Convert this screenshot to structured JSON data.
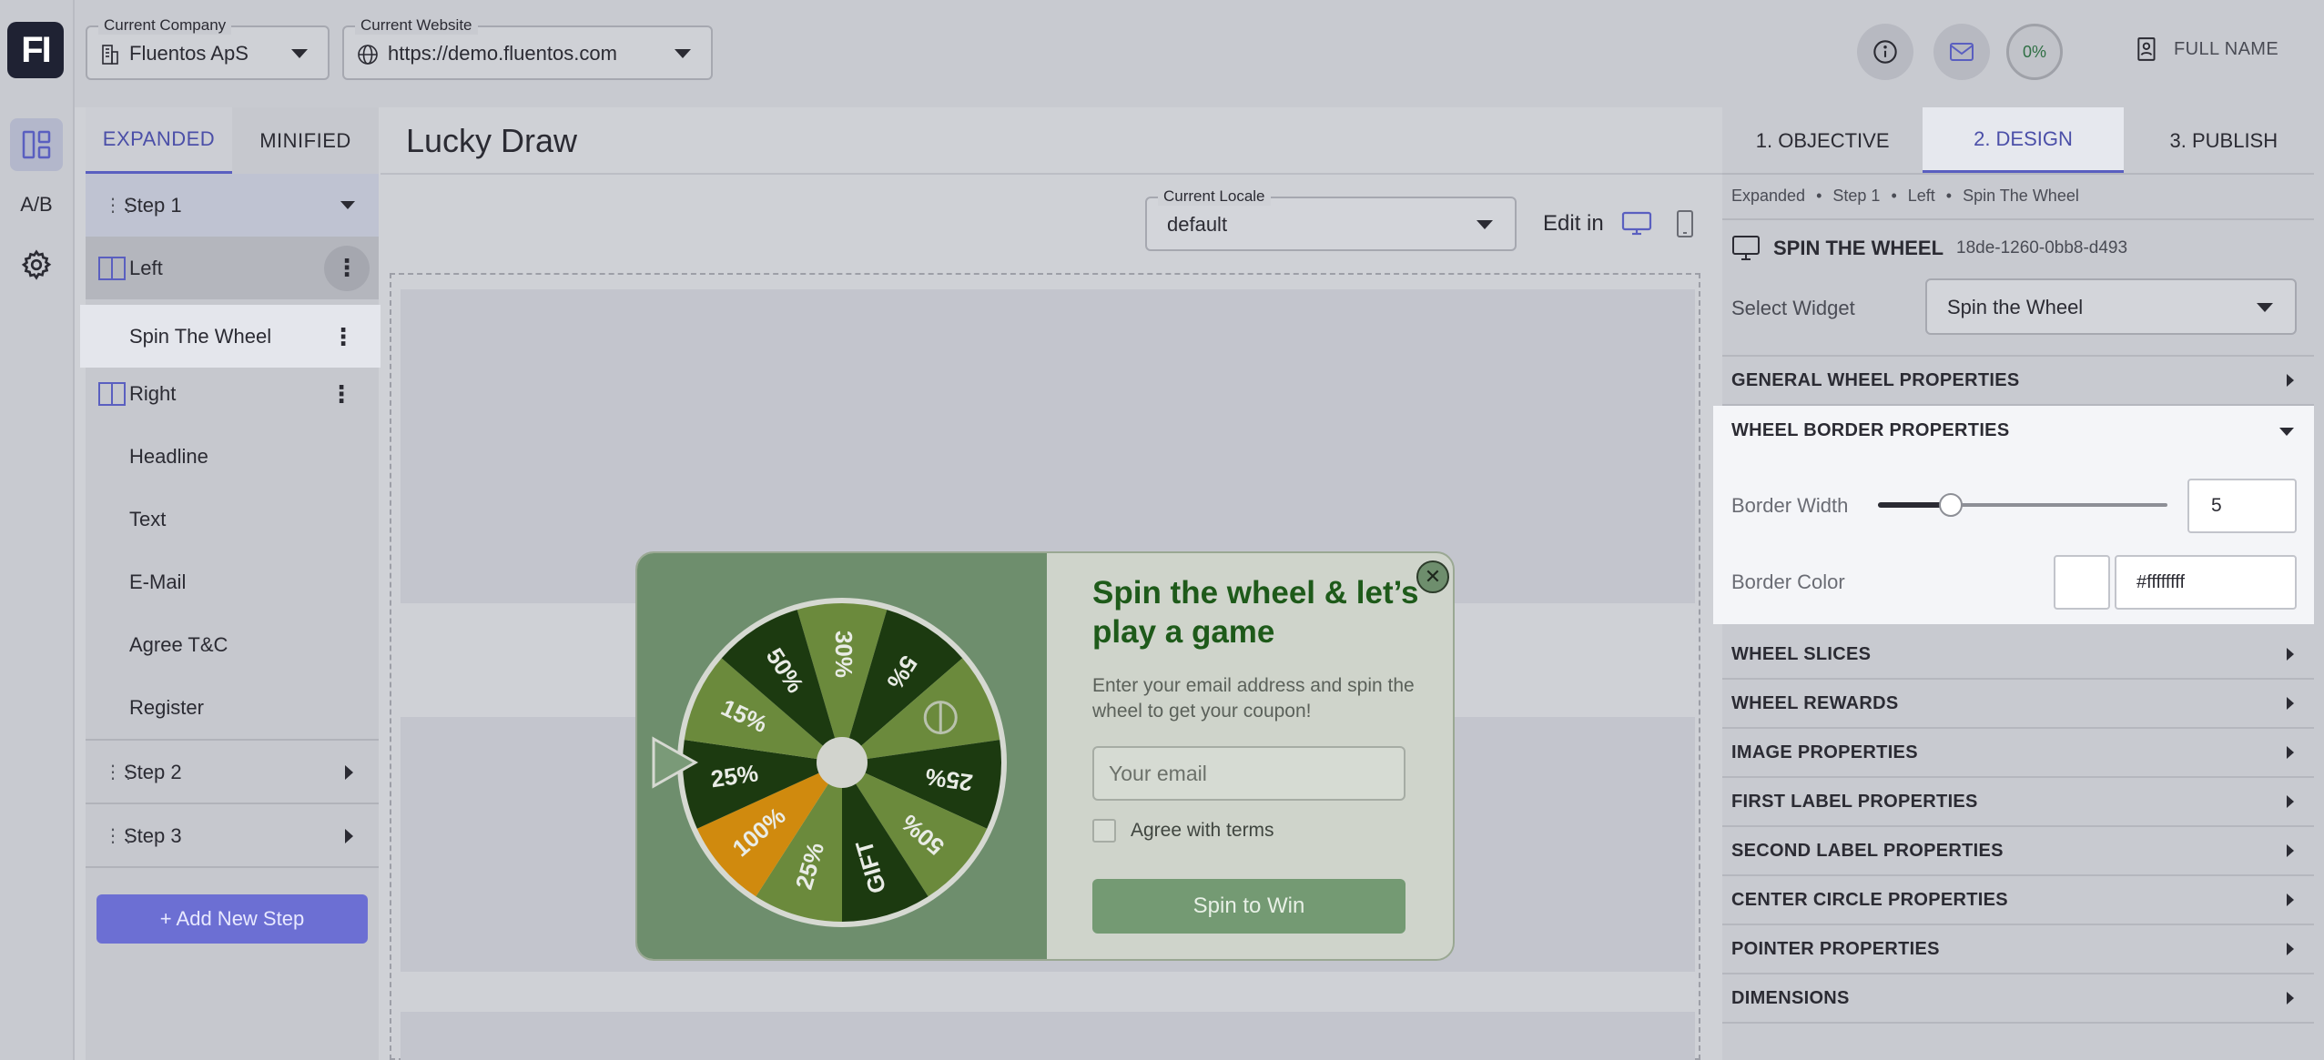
{
  "app": {
    "logo": "FI",
    "ab_label": "A/B"
  },
  "topbar": {
    "company_label": "Current Company",
    "company_value": "Fluentos ApS",
    "website_label": "Current Website",
    "website_value": "https://demo.fluentos.com",
    "progress": "0%",
    "user_name": "FULL NAME"
  },
  "tree": {
    "tabs": [
      "EXPANDED",
      "MINIFIED"
    ],
    "selected_tab": "EXPANDED",
    "items": [
      {
        "label": "Step 1",
        "kind": "step",
        "expanded": true
      },
      {
        "label": "Left",
        "kind": "column"
      },
      {
        "label": "Spin The Wheel",
        "kind": "widget",
        "selected": true
      },
      {
        "label": "Right",
        "kind": "column"
      },
      {
        "label": "Headline",
        "kind": "widget"
      },
      {
        "label": "Text",
        "kind": "widget"
      },
      {
        "label": "E-Mail",
        "kind": "widget"
      },
      {
        "label": "Agree T&C",
        "kind": "widget"
      },
      {
        "label": "Register",
        "kind": "widget"
      },
      {
        "label": "Step 2",
        "kind": "step",
        "expanded": false
      },
      {
        "label": "Step 3",
        "kind": "step",
        "expanded": false
      }
    ],
    "add_step": "+ Add New Step"
  },
  "canvas": {
    "title": "Lucky Draw",
    "locale_label": "Current Locale",
    "locale_value": "default",
    "edit_in": "Edit in"
  },
  "popup": {
    "title": "Spin the wheel & let’s play a game",
    "description": "Enter your email address and spin the wheel to get your coupon!",
    "email_placeholder": "Your email",
    "agree_label": "Agree with terms",
    "button": "Spin to Win",
    "close": "✕",
    "wheel": {
      "slices": [
        "30%",
        "5%",
        "",
        "25%",
        "50%",
        "GIFT",
        "25%",
        "100%",
        "25%",
        "15%",
        "50%"
      ],
      "slice_colors": [
        "#6b8a3c",
        "#1c3a10",
        "#6b8a3c",
        "#1c3a10",
        "#6b8a3c",
        "#1c3a10",
        "#6b8a3c",
        "#d08a0e",
        "#1c3a10",
        "#6b8a3c",
        "#1c3a10"
      ],
      "border_color": "#d6d9d2",
      "center_color": "#d2d4ce"
    }
  },
  "right": {
    "tabs": [
      "1. OBJECTIVE",
      "2. DESIGN",
      "3. PUBLISH"
    ],
    "selected_tab": "2. DESIGN",
    "breadcrumb": [
      "Expanded",
      "Step 1",
      "Left",
      "Spin The Wheel"
    ],
    "widget_title": "SPIN THE WHEEL",
    "widget_id": "18de-1260-0bb8-d493",
    "select_widget_label": "Select Widget",
    "select_widget_value": "Spin the Wheel",
    "sections": {
      "general": "GENERAL WHEEL PROPERTIES",
      "border": "WHEEL BORDER PROPERTIES",
      "slices": "WHEEL SLICES",
      "rewards": "WHEEL REWARDS",
      "image": "IMAGE PROPERTIES",
      "first_label": "FIRST LABEL PROPERTIES",
      "second_label": "SECOND LABEL PROPERTIES",
      "center": "CENTER CIRCLE PROPERTIES",
      "pointer": "POINTER PROPERTIES",
      "dimensions": "DIMENSIONS"
    },
    "border": {
      "width_label": "Border Width",
      "width_value": "5",
      "width_fraction": 0.25,
      "color_label": "Border Color",
      "color_value": "#ffffffff"
    }
  },
  "colors": {
    "accent": "#5a5fc0",
    "popup_green": "#1e5a1a",
    "add_step_bg": "#6c6fd3"
  }
}
